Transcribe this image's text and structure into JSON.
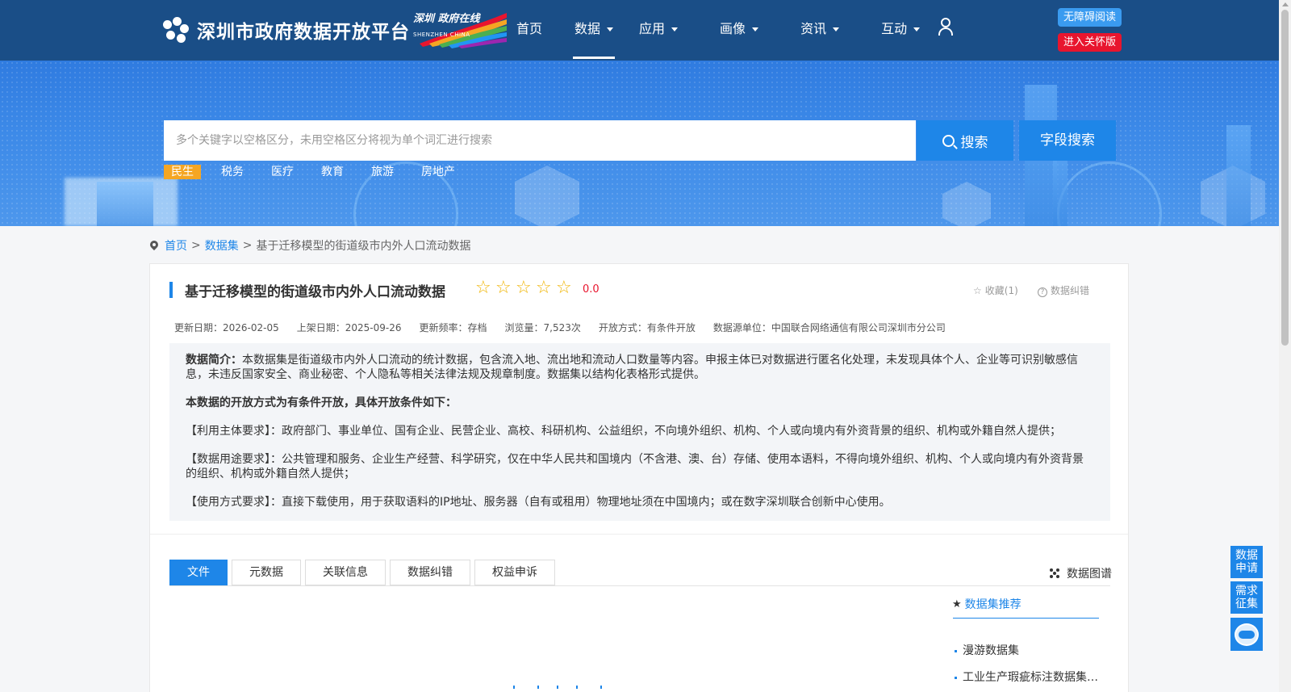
{
  "header": {
    "logo_icon": "molecule-logo-icon",
    "site_title": "深圳市政府数据开放平台",
    "brand_cn": "深圳 政府在线",
    "brand_en": "SHENZHEN CHINA",
    "nav": [
      {
        "label": "首页",
        "dropdown": false
      },
      {
        "label": "数据",
        "dropdown": true,
        "active": true
      },
      {
        "label": "应用",
        "dropdown": true
      },
      {
        "label": "画像",
        "dropdown": true
      },
      {
        "label": "资讯",
        "dropdown": true
      },
      {
        "label": "互动",
        "dropdown": true
      }
    ],
    "user_icon": "user-icon",
    "accessibility_label": "无障碍阅读",
    "elder_mode_label": "进入关怀版"
  },
  "search": {
    "placeholder": "多个关键字以空格区分，未用空格区分将视为单个词汇进行搜索",
    "search_label": "搜索",
    "field_search_label": "字段搜索",
    "tags": [
      "民生",
      "税务",
      "医疗",
      "教育",
      "旅游",
      "房地产"
    ],
    "active_tag": "民生"
  },
  "breadcrumb": {
    "home": "首页",
    "sep1": ">",
    "datasets": "数据集",
    "sep2": ">",
    "current": "基于迁移模型的街道级市内外人口流动数据"
  },
  "dataset": {
    "title": "基于迁移模型的街道级市内外人口流动数据",
    "rating_max": 5,
    "rating_value": 0,
    "score": "0.0",
    "favorite": "收藏(1)",
    "correction": "数据纠错",
    "meta": [
      "更新日期：2026-02-05",
      "上架日期：2025-09-26",
      "更新频率：存档",
      "浏览量：7,523次",
      "开放方式：有条件开放",
      "数据源单位：中国联合网络通信有限公司深圳市分公司"
    ],
    "intro_label": "数据简介：",
    "intro_text": "本数据集是街道级市内外人口流动的统计数据，包含流入地、流出地和流动人口数量等内容。申报主体已对数据进行匿名化处理，未发现具体个人、企业等可识别敏感信息，未违反国家安全、商业秘密、个人隐私等相关法律法规及规章制度。数据集以结构化表格形式提供。",
    "conditions_heading": "本数据的开放方式为有条件开放，具体开放条件如下：",
    "cond_subject": "【利用主体要求】：政府部门、事业单位、国有企业、民营企业、高校、科研机构、公益组织，不向境外组织、机构、个人或向境内有外资背景的组织、机构或外籍自然人提供；",
    "cond_purpose": "【数据用途要求】：公共管理和服务、企业生产经营、科学研究，仅在中华人民共和国境内（不含港、澳、台）存储、使用本语料，不得向境外组织、机构、个人或向境内有外资背景的组织、机构或外籍自然人提供；",
    "cond_usage": "【使用方式要求】：直接下载使用，用于获取语料的IP地址、服务器（自有或租用）物理地址须在中国境内；或在数字深圳联合创新中心使用。"
  },
  "tabs": {
    "items": [
      "文件",
      "元数据",
      "关联信息",
      "数据纠错",
      "权益申诉"
    ],
    "active": 0,
    "graph_label": "数据图谱"
  },
  "recommend": {
    "title": "数据集推荐",
    "items": [
      "漫游数据集",
      "工业生产瑕疵标注数据集…"
    ]
  },
  "float": {
    "apply": [
      "数据",
      "申请"
    ],
    "demand": [
      "需求",
      "征集"
    ],
    "bot_icon": "robot-assistant-icon"
  },
  "colors": {
    "header_bg": "#1a4e87",
    "accent": "#1e86e8",
    "tag_active": "#f5a623",
    "star": "#f0b400",
    "danger": "#e8152e"
  }
}
